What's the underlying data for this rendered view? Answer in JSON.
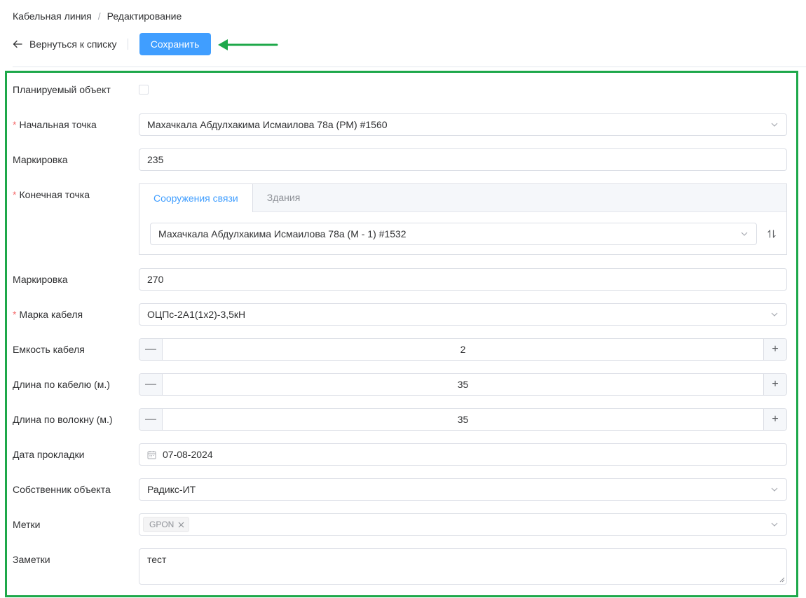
{
  "breadcrumb": {
    "parent": "Кабельная линия",
    "separator": "/",
    "current": "Редактирование"
  },
  "toolbar": {
    "back_label": "Вернуться к списку",
    "save_label": "Сохранить"
  },
  "colors": {
    "accent": "#409eff",
    "annotation": "#1ea84a",
    "required": "#f56c6c"
  },
  "form": {
    "planned": {
      "label": "Планируемый объект",
      "checked": false
    },
    "start_point": {
      "label": "Начальная точка",
      "required_mark": "*",
      "value": "Махачкала Абдулхакима Исмаилова 78а (РМ) #1560"
    },
    "marking1": {
      "label": "Маркировка",
      "value": "235"
    },
    "end_point": {
      "label": "Конечная точка",
      "required_mark": "*",
      "tabs": [
        "Сооружения связи",
        "Здания"
      ],
      "active_tab": "Сооружения связи",
      "value": "Махачкала Абдулхакима Исмаилова 78а (М - 1) #1532"
    },
    "marking2": {
      "label": "Маркировка",
      "value": "270"
    },
    "cable_brand": {
      "label": "Марка кабеля",
      "required_mark": "*",
      "value": "ОЦПс-2А1(1х2)-3,5кН"
    },
    "capacity": {
      "label": "Емкость кабеля",
      "value": "2",
      "minus": "—",
      "plus": "+"
    },
    "cable_length": {
      "label": "Длина по кабелю (м.)",
      "value": "35",
      "minus": "—",
      "plus": "+"
    },
    "fiber_length": {
      "label": "Длина по волокну (м.)",
      "value": "35",
      "minus": "—",
      "plus": "+"
    },
    "laying_date": {
      "label": "Дата прокладки",
      "value": "07-08-2024"
    },
    "owner": {
      "label": "Собственник объекта",
      "value": "Радикс-ИТ"
    },
    "tags": {
      "label": "Метки",
      "items": [
        "GPON"
      ]
    },
    "notes": {
      "label": "Заметки",
      "value": "тест"
    }
  }
}
